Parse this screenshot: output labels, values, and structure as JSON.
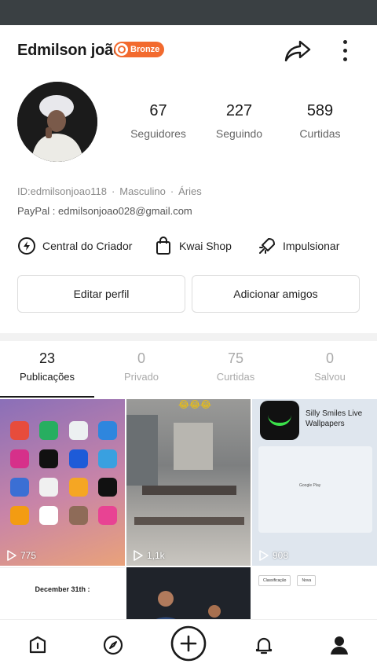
{
  "profile": {
    "name": "Edmilson joão",
    "badge": "Bronze",
    "stats": [
      {
        "value": "67",
        "label": "Seguidores"
      },
      {
        "value": "227",
        "label": "Seguindo"
      },
      {
        "value": "589",
        "label": "Curtidas"
      }
    ],
    "id": "ID:edmilsonjoao118",
    "gender": "Masculino",
    "sign": "Áries",
    "paypal": "PayPal : edmilsonjoao028@gmail.com"
  },
  "tools": [
    {
      "label": "Central do Criador",
      "icon": "bolt-icon"
    },
    {
      "label": "Kwai Shop",
      "icon": "bag-icon"
    },
    {
      "label": "Impulsionar",
      "icon": "rocket-icon"
    }
  ],
  "buttons": {
    "edit": "Editar perfil",
    "add": "Adicionar amigos"
  },
  "tabs": [
    {
      "value": "23",
      "label": "Publicações",
      "active": true
    },
    {
      "value": "0",
      "label": "Privado"
    },
    {
      "value": "75",
      "label": "Curtidas"
    },
    {
      "value": "0",
      "label": "Salvou"
    }
  ],
  "posts": [
    {
      "plays": "775"
    },
    {
      "plays": "1,1k",
      "overlay": "😂😂😂"
    },
    {
      "plays": "908",
      "ad_title": "Silly Smiles Live Wallpapers",
      "store": "Google Play"
    },
    {
      "caption": "December 31th :"
    },
    {},
    {
      "filter1": "Classificação",
      "filter2": "Nova"
    }
  ],
  "colors": {
    "badge": "#f26a2e",
    "status_bar": "#3a4043"
  }
}
